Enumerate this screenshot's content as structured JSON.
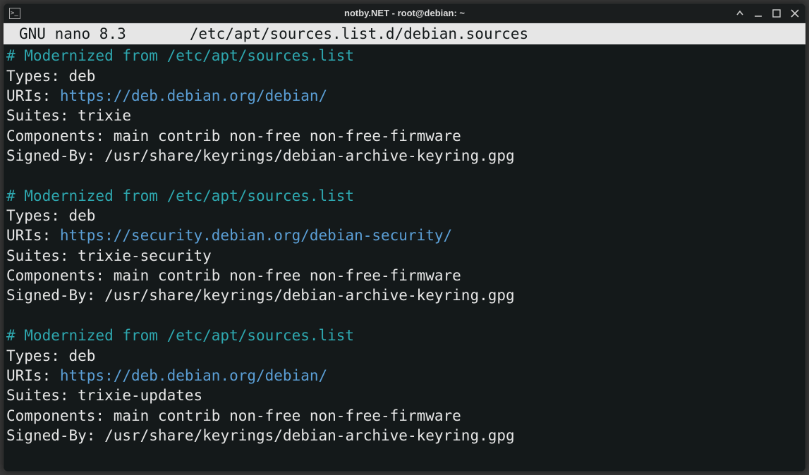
{
  "window": {
    "title": "notby.NET - root@debian: ~"
  },
  "nano": {
    "app": "GNU nano 8.3",
    "filename": "/etc/apt/sources.list.d/debian.sources"
  },
  "blocks": [
    {
      "comment": "# Modernized from /etc/apt/sources.list",
      "types_label": "Types: ",
      "types_value": "deb",
      "uris_label": "URIs: ",
      "uris_value": "https://deb.debian.org/debian/",
      "suites_label": "Suites: ",
      "suites_value": "trixie",
      "components_label": "Components: ",
      "components_value": "main contrib non-free non-free-firmware",
      "signedby_label": "Signed-By: ",
      "signedby_value": "/usr/share/keyrings/debian-archive-keyring.gpg"
    },
    {
      "comment": "# Modernized from /etc/apt/sources.list",
      "types_label": "Types: ",
      "types_value": "deb",
      "uris_label": "URIs: ",
      "uris_value": "https://security.debian.org/debian-security/",
      "suites_label": "Suites: ",
      "suites_value": "trixie-security",
      "components_label": "Components: ",
      "components_value": "main contrib non-free non-free-firmware",
      "signedby_label": "Signed-By: ",
      "signedby_value": "/usr/share/keyrings/debian-archive-keyring.gpg"
    },
    {
      "comment": "# Modernized from /etc/apt/sources.list",
      "types_label": "Types: ",
      "types_value": "deb",
      "uris_label": "URIs: ",
      "uris_value": "https://deb.debian.org/debian/",
      "suites_label": "Suites: ",
      "suites_value": "trixie-updates",
      "components_label": "Components: ",
      "components_value": "main contrib non-free non-free-firmware",
      "signedby_label": "Signed-By: ",
      "signedby_value": "/usr/share/keyrings/debian-archive-keyring.gpg"
    }
  ]
}
